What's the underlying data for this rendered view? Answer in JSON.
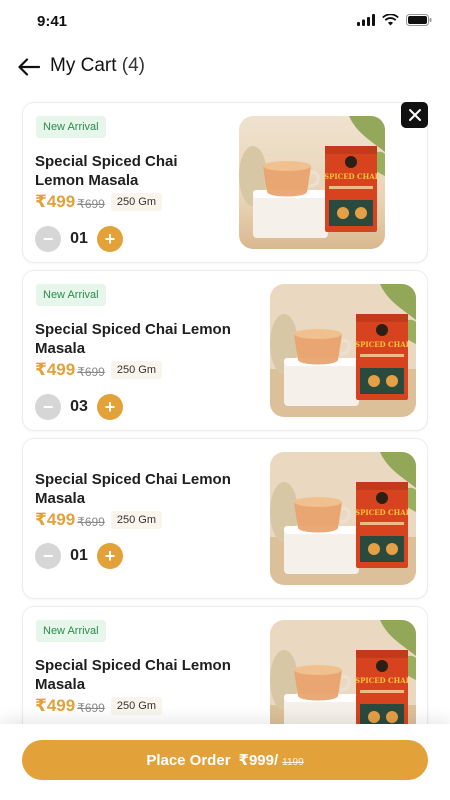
{
  "status_bar": {
    "time": "9:41"
  },
  "header": {
    "title": "My Cart",
    "count": "(4)"
  },
  "cart": {
    "items": [
      {
        "badge": "New Arrival",
        "name": "Special Spiced Chai Lemon Masala",
        "price": "₹499",
        "mrp": "₹699",
        "weight": "250 Gm",
        "quantity": "01",
        "pack_label": "SPICED CHAI"
      },
      {
        "badge": "New Arrival",
        "name": "Special Spiced Chai Lemon Masala",
        "price": "₹499",
        "mrp": "₹699",
        "weight": "250 Gm",
        "quantity": "03",
        "pack_label": "SPICED CHAI"
      },
      {
        "badge": "",
        "name": "Special Spiced Chai Lemon Masala",
        "price": "₹499",
        "mrp": "₹699",
        "weight": "250 Gm",
        "quantity": "01",
        "pack_label": "SPICED CHAI"
      },
      {
        "badge": "New Arrival",
        "name": "Special Spiced Chai Lemon Masala",
        "price": "₹499",
        "mrp": "₹699",
        "weight": "250 Gm",
        "quantity": "",
        "pack_label": "SPICED CHAI"
      }
    ]
  },
  "footer": {
    "place_order_label": "Place Order",
    "total": "₹999/",
    "old_total": "1199"
  },
  "colors": {
    "accent": "#e3a13a",
    "badge_bg": "#e6f6ea",
    "badge_text": "#2e8b48"
  }
}
